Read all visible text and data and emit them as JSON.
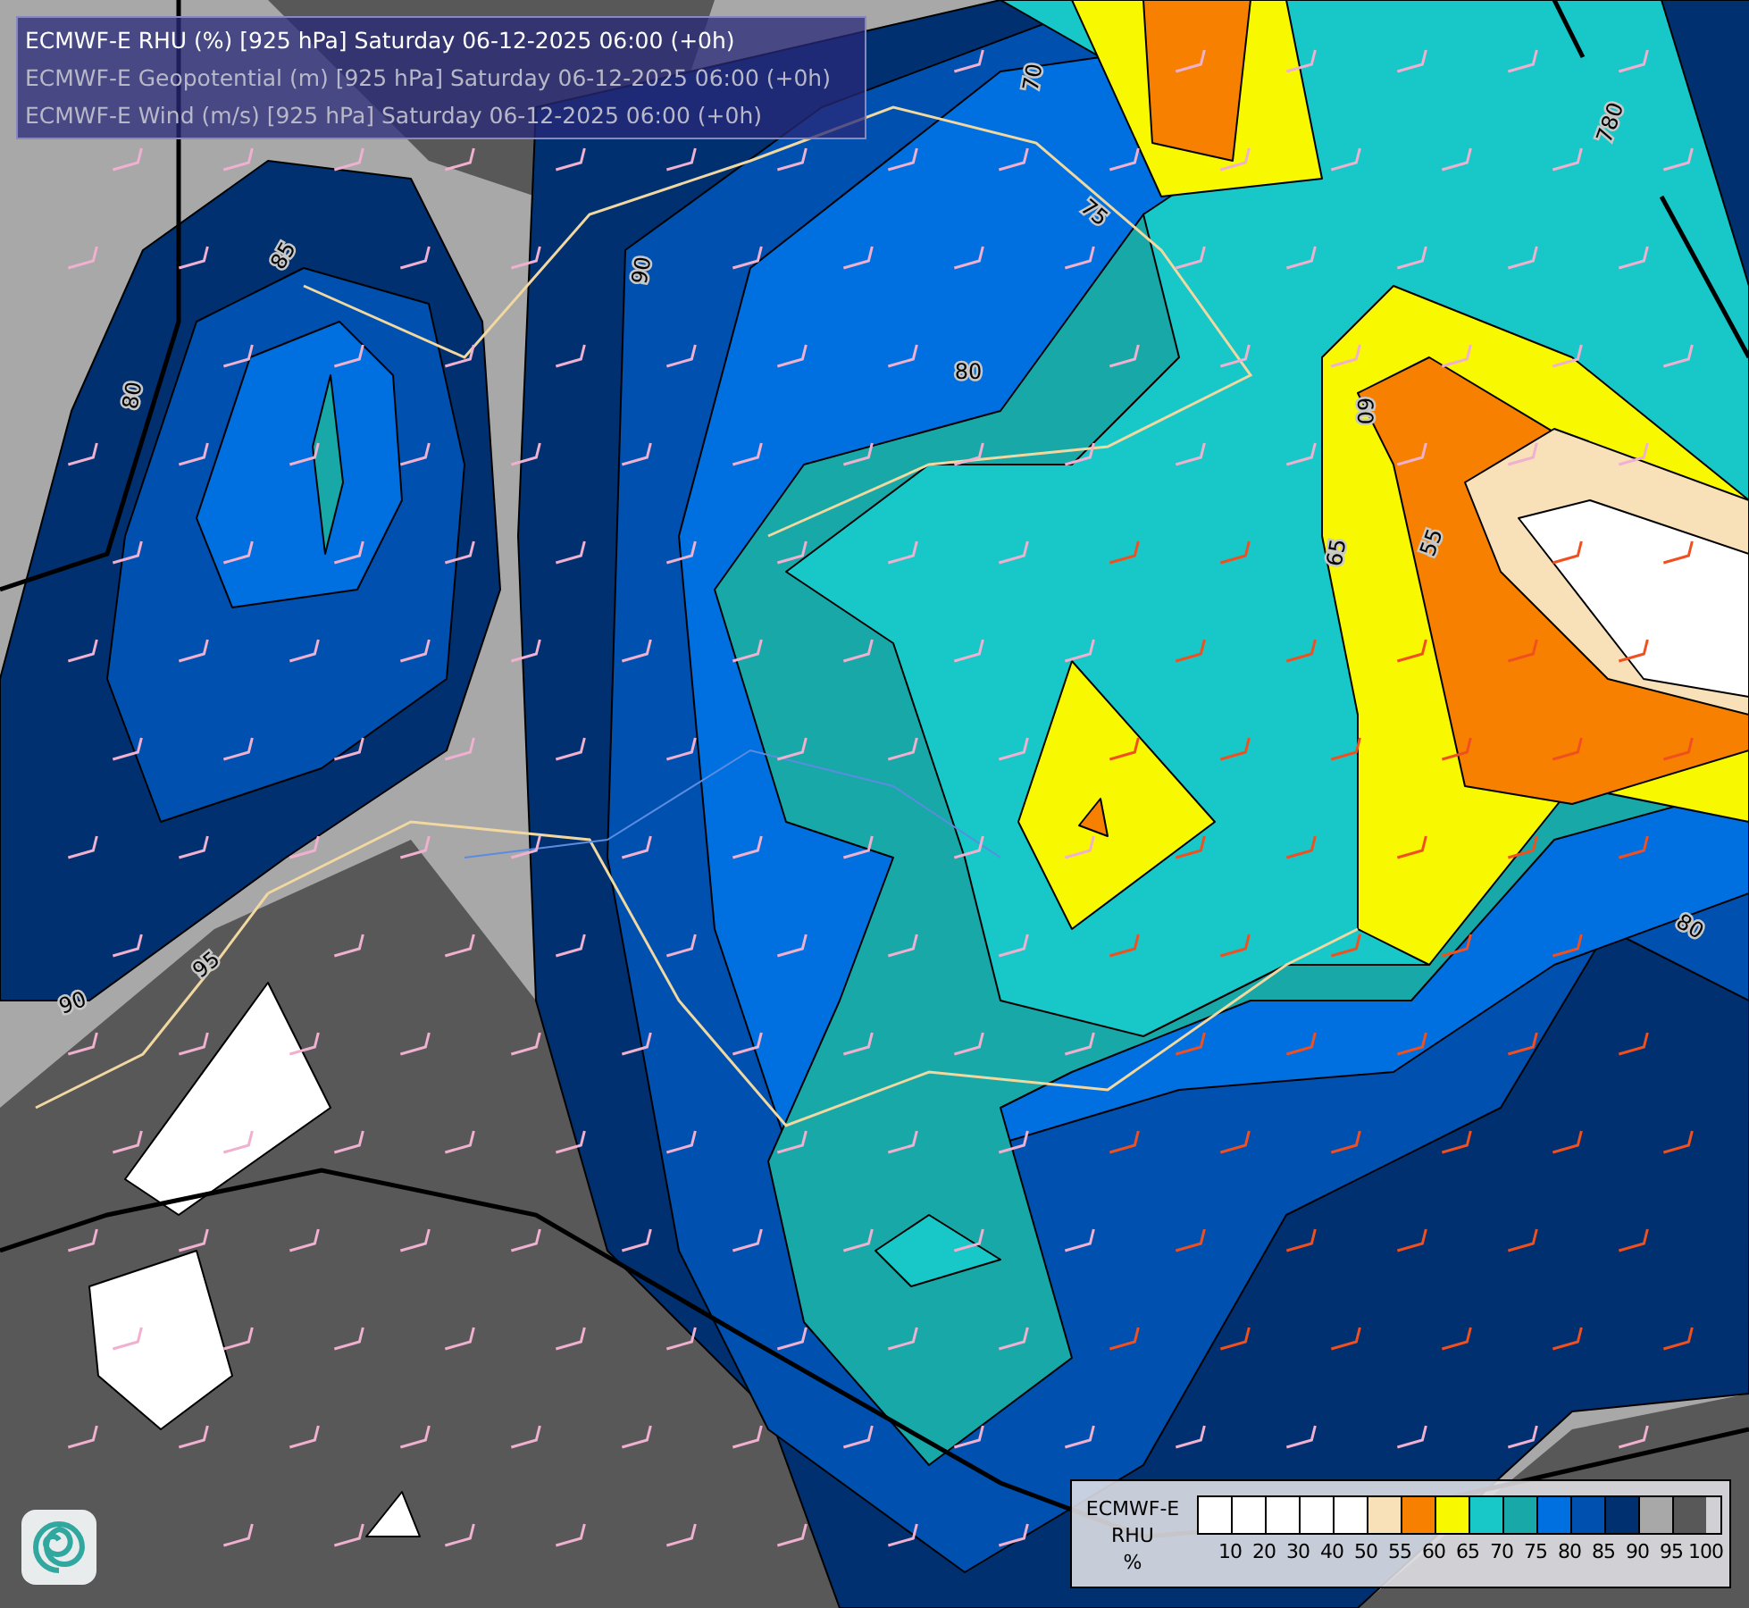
{
  "title_box": {
    "lines": [
      {
        "text": "ECMWF-E RHU (%) [925 hPa] Saturday 06-12-2025 06:00 (+0h)",
        "active": true
      },
      {
        "text": "ECMWF-E Geopotential (m) [925 hPa] Saturday 06-12-2025 06:00 (+0h)",
        "active": false
      },
      {
        "text": "ECMWF-E Wind (m/s) [925 hPa] Saturday 06-12-2025 06:00 (+0h)",
        "active": false
      }
    ]
  },
  "contour_labels": [
    "70",
    "75",
    "80",
    "85",
    "90",
    "80",
    "60",
    "65",
    "55",
    "80",
    "95",
    "90",
    "780"
  ],
  "legend": {
    "title": [
      "ECMWF-E",
      "RHU",
      "%"
    ],
    "swatches": [
      {
        "color": "#ffffff"
      },
      {
        "color": "#ffffff"
      },
      {
        "color": "#ffffff"
      },
      {
        "color": "#ffffff"
      },
      {
        "color": "#ffffff"
      },
      {
        "color": "#f8e0b8"
      },
      {
        "color": "#f88000"
      },
      {
        "color": "#f8f800"
      },
      {
        "color": "#18c8c8"
      },
      {
        "color": "#18a8a8"
      },
      {
        "color": "#0070e0"
      },
      {
        "color": "#0050b0"
      },
      {
        "color": "#003070"
      },
      {
        "color": "#a8a8a8"
      },
      {
        "color": "#585858"
      }
    ],
    "ticks": [
      "10",
      "20",
      "30",
      "40",
      "50",
      "55",
      "60",
      "65",
      "70",
      "75",
      "80",
      "85",
      "90",
      "95",
      "100"
    ]
  }
}
